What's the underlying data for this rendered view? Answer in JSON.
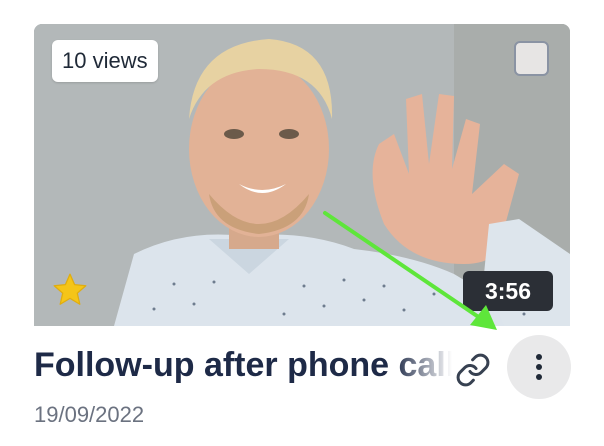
{
  "card": {
    "views_label": "10 views",
    "duration": "3:56",
    "title": "Follow-up after phone call",
    "date": "19/09/2022",
    "favorite": true,
    "selected": false
  },
  "icons": {
    "favorite": "star-icon",
    "link": "link-icon",
    "menu": "more-vertical-icon"
  },
  "colors": {
    "title": "#1e2a47",
    "star": "#f5c518",
    "duration_bg": "#2b2f36",
    "annotation_arrow": "#5ee63a"
  }
}
